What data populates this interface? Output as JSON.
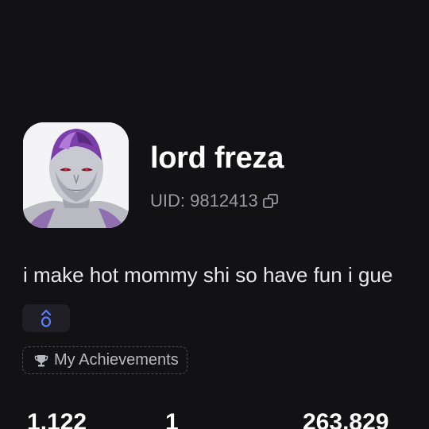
{
  "profile": {
    "username": "lord freza",
    "uid_text": "UID: 9812413",
    "bio": "i make hot mommy shi so have fun i gue"
  },
  "icons": {
    "copy": "copy-icon",
    "badge": "ladder-badge-icon",
    "trophy": "trophy-icon"
  },
  "achievements": {
    "label": "My Achievements"
  },
  "stats": [
    {
      "value": "1,122"
    },
    {
      "value": "1"
    },
    {
      "value": "263,829"
    }
  ],
  "colors": {
    "background": "#121214",
    "muted_text": "#9a9aa3",
    "badge_accent": "#5b7cff"
  }
}
